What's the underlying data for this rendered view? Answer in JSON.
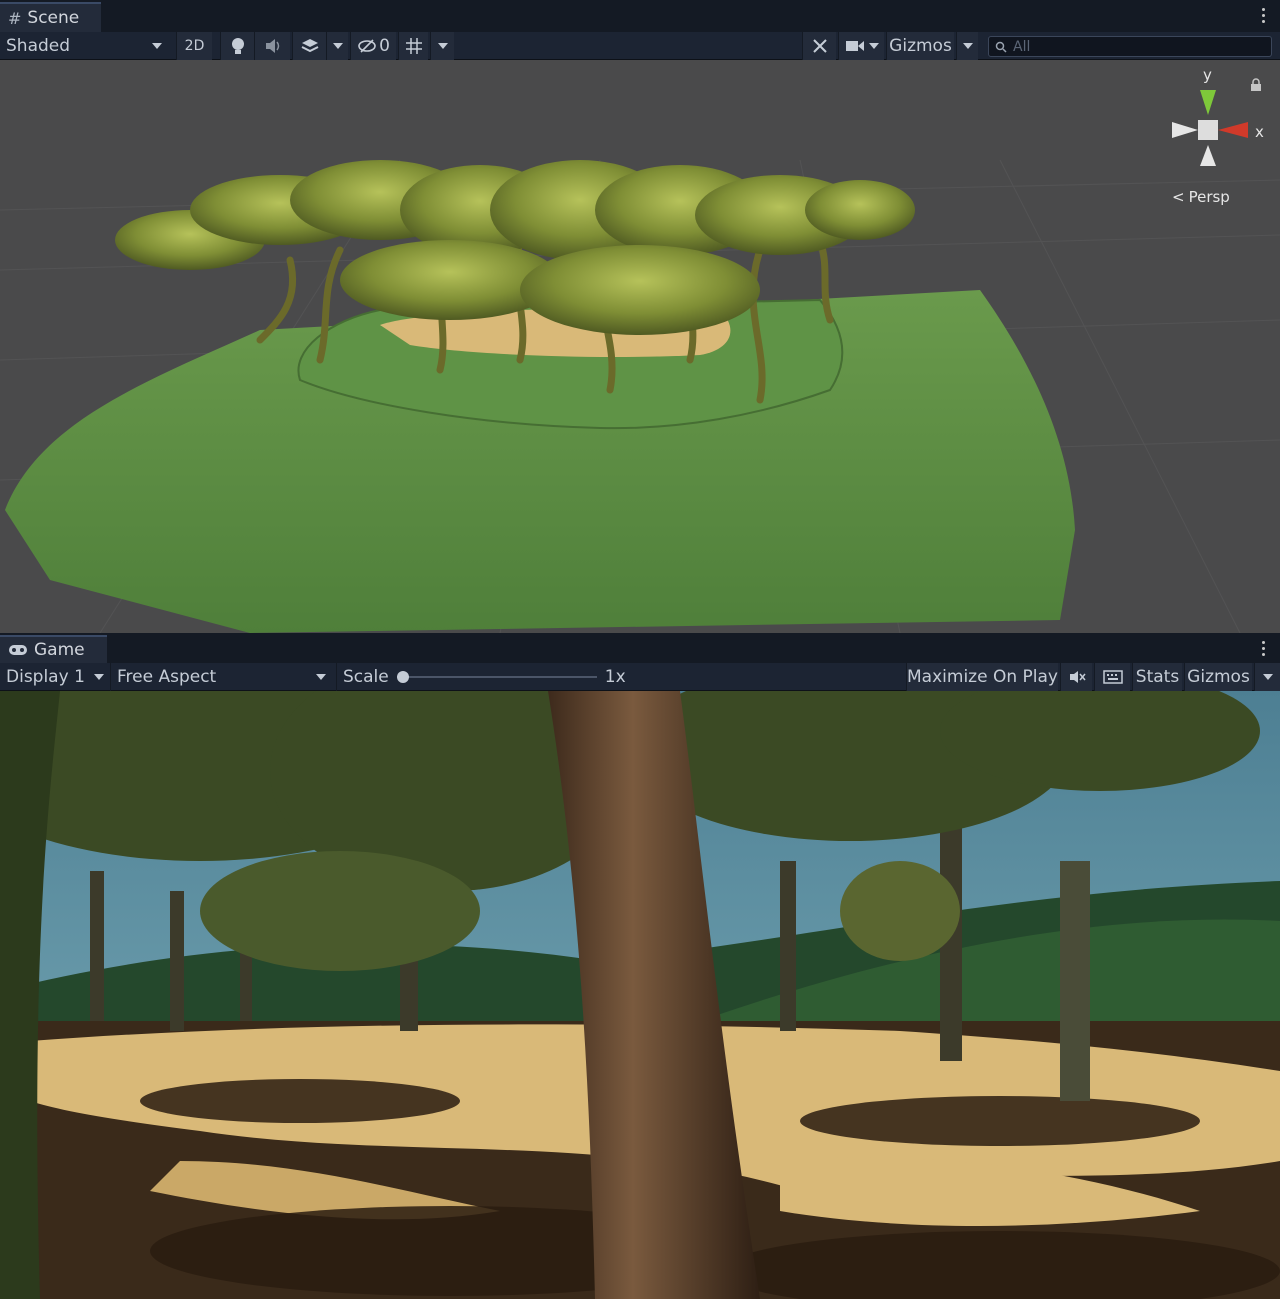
{
  "scene": {
    "tab_label": "Scene",
    "shading_mode": "Shaded",
    "mode_2d": "2D",
    "hidden_count": "0",
    "gizmos_label": "Gizmos",
    "search_placeholder": "All",
    "axis_y": "y",
    "axis_x": "x",
    "projection": "Persp"
  },
  "game": {
    "tab_label": "Game",
    "display": "Display 1",
    "aspect": "Free Aspect",
    "scale_label": "Scale",
    "scale_value": "1x",
    "maximize_label": "Maximize On Play",
    "stats_label": "Stats",
    "gizmos_label": "Gizmos"
  },
  "colors": {
    "toolbar": "#1c2433",
    "tab": "#232b3a",
    "scene_bg": "#4a4a4b",
    "terrain": "#5e8f45",
    "sand": "#d9b978",
    "sky": "#5d8ea0"
  }
}
